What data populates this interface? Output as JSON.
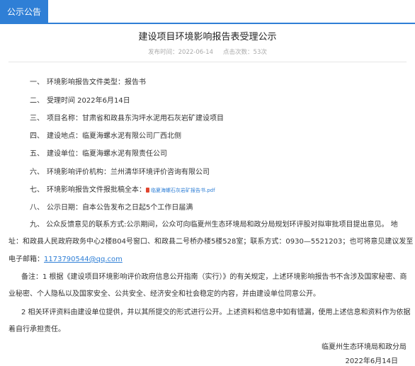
{
  "header": {
    "tab_label": "公示公告"
  },
  "article": {
    "title": "建设项目环境影响报告表受理公示",
    "meta": {
      "date_label": "发布时间：",
      "date": "2022-06-14",
      "views_label": "点击次数：",
      "views": "53次"
    },
    "items": [
      {
        "num": "一、",
        "text": "环境影响报告文件类型：报告书"
      },
      {
        "num": "二、",
        "text": "受理时间 2022年6月14日"
      },
      {
        "num": "三、",
        "text": "项目名称：甘肃省和政县东沟坪水泥用石灰岩矿建设项目"
      },
      {
        "num": "四、",
        "text": "建设地点：临夏海螺水泥有限公司厂西北侧"
      },
      {
        "num": "五、",
        "text": "建设单位：临夏海螺水泥有限责任公司"
      },
      {
        "num": "六、",
        "text": "环境影响评价机构：兰州清华环境评价咨询有限公司"
      },
      {
        "num": "七、",
        "text": "环境影响报告文件报批稿全本："
      },
      {
        "num": "八、",
        "text": "公示日期：自本公告发布之日起5个工作日届满"
      }
    ],
    "attachment": "临夏海螺石灰岩矿报告书.pdf",
    "item9": {
      "line1": "九、  公众反馈意见的联系方式:公示期间，公众可向临夏州生态环境局和政分局规划环评股对拟审批项目提出意见。  地",
      "line2": "址：和政县人民政府政务中心2楼B04号窗口、和政县二号桥办楼5楼528室；联系方式：0930—5521203；也可将意见建议发至",
      "line3_prefix": "电子邮箱：",
      "email": "1173790544@qq.com"
    },
    "note": {
      "line1": "备注：1 根据《建设项目环境影响评价政府信息公开指南（实行）》的有关规定，上述环境影响报告书不含涉及国家秘密、商",
      "line2": "业秘密、个人隐私以及国家安全、公共安全、经济安全和社会稳定的内容，并由建设单位同意公开。",
      "line3": "2 相关环评资料由建设单位提供，并以其所提交的形式进行公开。上述资料和信息中如有错漏，使用上述信息和资料作为依据",
      "line4": "着自行承担责任。"
    },
    "signature": {
      "org": "临夏州生态环境局和政分局",
      "date": "2022年6月14日"
    }
  }
}
